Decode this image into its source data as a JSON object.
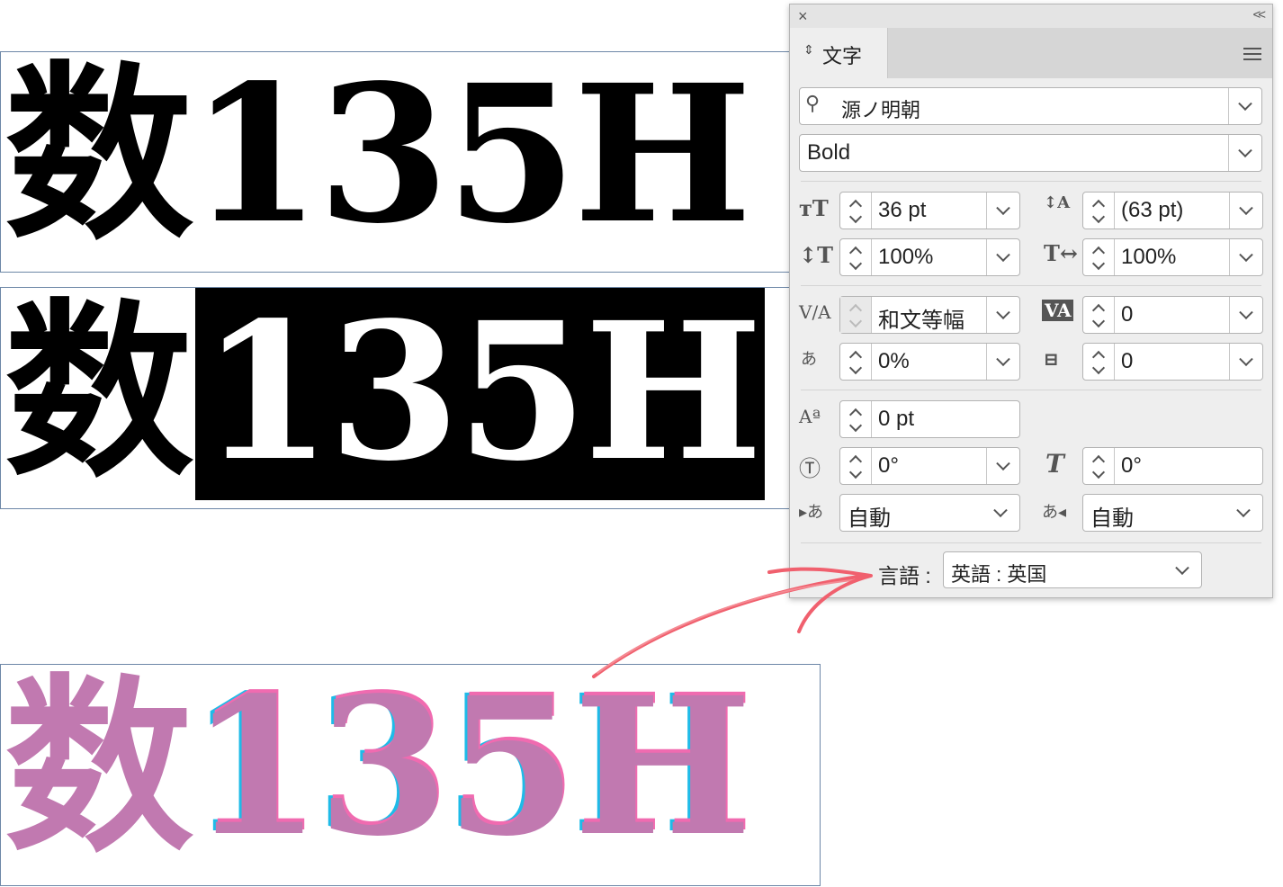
{
  "canvas": {
    "frames": [
      {
        "kanji": "数",
        "digits": "135H"
      },
      {
        "kanji": "数",
        "digits": "135H"
      },
      {
        "kanji": "数",
        "digits": "135H"
      }
    ],
    "colors": {
      "selection_bg": "#000000",
      "pink": "#c179b0",
      "cyan": "#1ebbe8",
      "arrow": "#f0606e"
    }
  },
  "panel": {
    "close_icon": "×",
    "collapse_icon": "<<",
    "tab_label": "文字",
    "font_family": "源ノ明朝",
    "font_style": "Bold",
    "font_size": "36 pt",
    "leading": "(63 pt)",
    "vertical_scale": "100%",
    "horizontal_scale": "100%",
    "kerning": "和文等幅",
    "tracking": "0",
    "tsume": "0%",
    "aki": "0",
    "baseline_shift": "0 pt",
    "rotation": "0°",
    "skew": "0°",
    "mojikumi_before": "自動",
    "mojikumi_after": "自動",
    "language_label": "言語 :",
    "language": "英語 : 英国"
  }
}
